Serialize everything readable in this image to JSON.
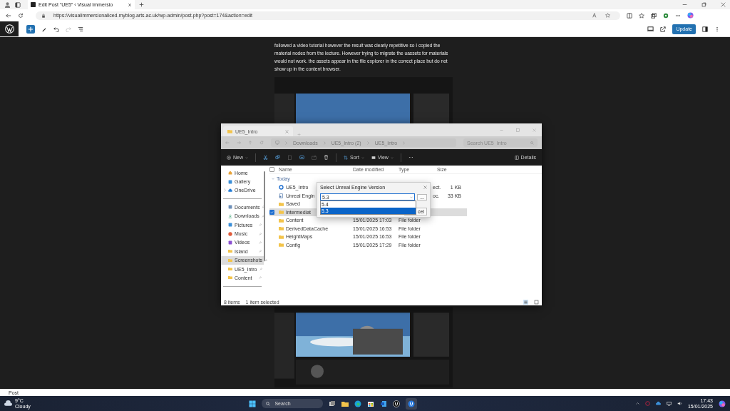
{
  "browser": {
    "tab_title": "Edit Post “UE5” ‹ Visual Immersio",
    "url": "https://visualimmersionaliced.myblog.arts.ac.uk/wp-admin/post.php?post=174&action=edit"
  },
  "editor": {
    "update_button": "Update",
    "paragraph": "followed a video tutorial however the result was clearly repetitive so I copied the material nodes from the lecture. However trying to migrate the uassets for materials would not work. the assets appear in the file explorer in the correct place but do not show up in the content browser.",
    "footer": "Post"
  },
  "explorer": {
    "tab_title": "UE5_Intro",
    "breadcrumbs": [
      "Downloads",
      "UE5_Intro (2)",
      "UE5_Intro"
    ],
    "search": {
      "placeholder": "Search UE5_Intro"
    },
    "toolbar": {
      "new": "New",
      "sort": "Sort",
      "view": "View",
      "more": "···",
      "details": "Details"
    },
    "sidebar": [
      {
        "label": "Home",
        "pinned": false,
        "has_children": false,
        "selected": false
      },
      {
        "label": "Gallery",
        "pinned": false,
        "has_children": false,
        "selected": false
      },
      {
        "label": "OneDrive",
        "pinned": false,
        "has_children": true,
        "selected": false
      },
      {
        "label": "Documents",
        "pinned": true,
        "has_children": false,
        "selected": false
      },
      {
        "label": "Downloads",
        "pinned": true,
        "has_children": false,
        "selected": false
      },
      {
        "label": "Pictures",
        "pinned": true,
        "has_children": false,
        "selected": false
      },
      {
        "label": "Music",
        "pinned": true,
        "has_children": false,
        "selected": false
      },
      {
        "label": "Videos",
        "pinned": true,
        "has_children": false,
        "selected": false
      },
      {
        "label": "Island",
        "pinned": true,
        "has_children": false,
        "selected": false
      },
      {
        "label": "Screenshots",
        "pinned": true,
        "has_children": false,
        "selected": true
      },
      {
        "label": "UE5_Intro",
        "pinned": true,
        "has_children": false,
        "selected": false
      },
      {
        "label": "Content",
        "pinned": true,
        "has_children": false,
        "selected": false
      }
    ],
    "select_all": {
      "checked": false
    },
    "columns": [
      "Name",
      "Date modified",
      "Type",
      "Size"
    ],
    "group": "Today",
    "files": [
      {
        "kind": "project",
        "name": "UE5_Intro",
        "type": "ect.",
        "size": "1 KB",
        "selected": false
      },
      {
        "kind": "document",
        "name": "Unreal Engin",
        "type": "oc.",
        "size": "33 KB",
        "selected": false
      },
      {
        "kind": "folder",
        "name": "Saved",
        "selected": false
      },
      {
        "kind": "folder",
        "name": "Intermediat",
        "selected": true
      },
      {
        "kind": "folder",
        "name": "Content",
        "date": "15/01/2025 17:03",
        "type": "File folder",
        "selected": false
      },
      {
        "kind": "folder",
        "name": "DerivedDataCache",
        "date": "15/01/2025 16:53",
        "type": "File folder",
        "selected": false
      },
      {
        "kind": "folder",
        "name": "HeightMaps",
        "date": "15/01/2025 16:53",
        "type": "File folder",
        "selected": false
      },
      {
        "kind": "folder",
        "name": "Config",
        "date": "15/01/2025 17:29",
        "type": "File folder",
        "selected": false
      }
    ],
    "status": {
      "items": "8 items",
      "selection": "1 item selected"
    },
    "dialog": {
      "title": "Select Unreal Engine Version",
      "value": "5.3",
      "browse": "...",
      "options": [
        {
          "label": "5.4",
          "selected": false
        },
        {
          "label": "5.3",
          "selected": true
        }
      ],
      "cancel": "cel"
    }
  },
  "taskbar": {
    "temperature": "9°C",
    "weather": "Cloudy",
    "search": "Search",
    "time": "17:43",
    "date": "15/01/2025"
  }
}
